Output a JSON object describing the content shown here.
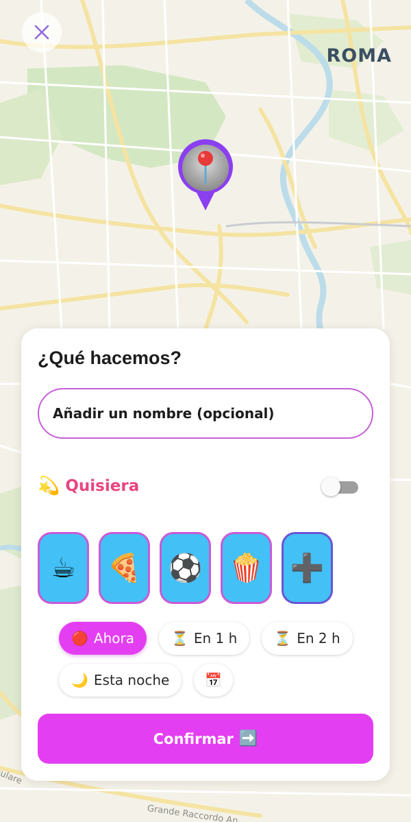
{
  "map": {
    "city_label": "ROMA",
    "road_labels": {
      "gra": "Grande Raccordo An",
      "anulare": "nulare"
    },
    "pin_icon": "round-pushpin-icon"
  },
  "close_icon": "close-icon",
  "sheet": {
    "title": "¿Qué hacemos?",
    "name_placeholder": "Añadir un nombre (opcional)",
    "wish": {
      "emoji": "💫",
      "label": "Quisiera",
      "toggle_on": false
    },
    "activities": [
      {
        "id": "coffee",
        "emoji": "☕",
        "icon": "coffee-icon"
      },
      {
        "id": "pizza",
        "emoji": "🍕",
        "icon": "pizza-icon"
      },
      {
        "id": "soccer",
        "emoji": "⚽",
        "icon": "soccer-ball-icon"
      },
      {
        "id": "popcorn",
        "emoji": "🍿",
        "icon": "popcorn-icon"
      },
      {
        "id": "add",
        "emoji": "➕",
        "icon": "plus-icon"
      }
    ],
    "times": [
      {
        "emoji": "🔴",
        "label": "Ahora",
        "active": true
      },
      {
        "emoji": "⏳",
        "label": "En 1 h",
        "active": false
      },
      {
        "emoji": "⏳",
        "label": "En 2 h",
        "active": false
      },
      {
        "emoji": "🌙",
        "label": "Esta noche",
        "active": false
      },
      {
        "emoji": "📅",
        "label": "",
        "active": false
      }
    ],
    "confirm": {
      "label": "Confirmar",
      "emoji": "➡️"
    }
  },
  "colors": {
    "accent": "#e43ef2",
    "wish_pink": "#e8457f",
    "tile_blue": "#43c0f5",
    "tile_border": "#c85ad8",
    "pin_purple": "#8a3ff0",
    "close_purple": "#8f6ad8"
  }
}
